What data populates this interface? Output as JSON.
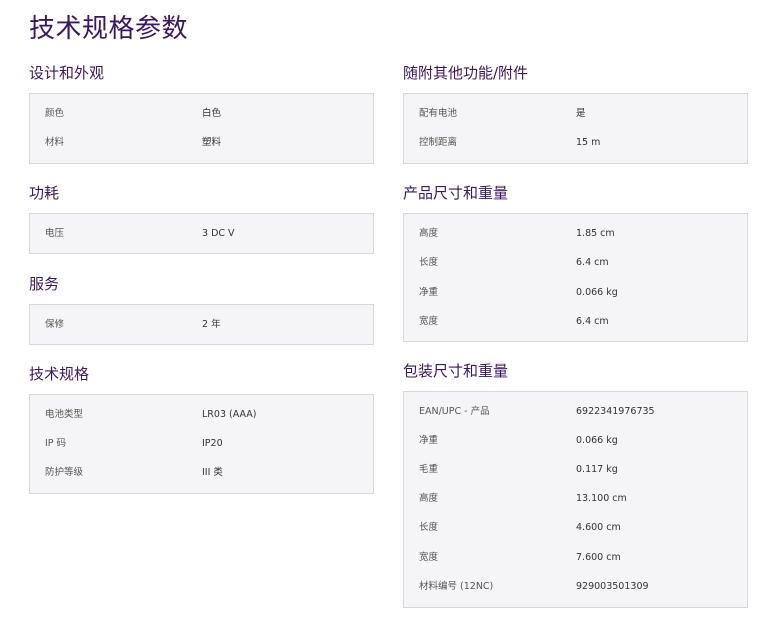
{
  "page": {
    "title": "技术规格参数"
  },
  "sections": {
    "design": {
      "title": "设计和外观",
      "rows": [
        {
          "label": "颜色",
          "value": "白色"
        },
        {
          "label": "材料",
          "value": "塑料"
        }
      ]
    },
    "power": {
      "title": "功耗",
      "rows": [
        {
          "label": "电压",
          "value": "3 DC V"
        }
      ]
    },
    "service": {
      "title": "服务",
      "rows": [
        {
          "label": "保修",
          "value": "2 年"
        }
      ]
    },
    "tech": {
      "title": "技术规格",
      "rows": [
        {
          "label": "电池类型",
          "value": "LR03 (AAA)"
        },
        {
          "label": "IP 码",
          "value": "IP20"
        },
        {
          "label": "防护等级",
          "value": "III 类"
        }
      ]
    },
    "accessories": {
      "title": "随附其他功能/附件",
      "rows": [
        {
          "label": "配有电池",
          "value": "是"
        },
        {
          "label": "控制距离",
          "value": "15 m"
        }
      ]
    },
    "product_dims": {
      "title": "产品尺寸和重量",
      "rows": [
        {
          "label": "高度",
          "value": "1.85 cm"
        },
        {
          "label": "长度",
          "value": "6.4 cm"
        },
        {
          "label": "净重",
          "value": "0.066 kg"
        },
        {
          "label": "宽度",
          "value": "6.4 cm"
        }
      ]
    },
    "package_dims": {
      "title": "包装尺寸和重量",
      "rows": [
        {
          "label": "EAN/UPC - 产品",
          "value": "6922341976735"
        },
        {
          "label": "净重",
          "value": "0.066 kg"
        },
        {
          "label": "毛重",
          "value": "0.117 kg"
        },
        {
          "label": "高度",
          "value": "13.100 cm"
        },
        {
          "label": "长度",
          "value": "4.600 cm"
        },
        {
          "label": "宽度",
          "value": "7.600 cm"
        },
        {
          "label": "材料编号 (12NC)",
          "value": "929003501309"
        }
      ]
    }
  }
}
